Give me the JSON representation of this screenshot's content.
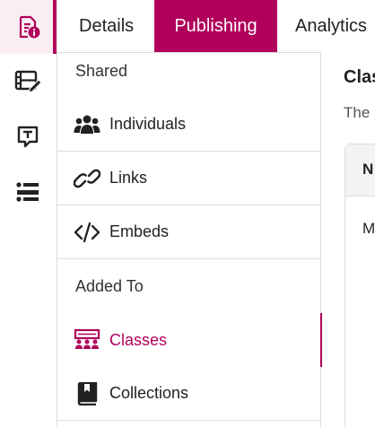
{
  "rail": {
    "items": [
      {
        "icon": "document-info-icon",
        "active": true
      },
      {
        "icon": "video-edit-icon",
        "active": false
      },
      {
        "icon": "text-box-icon",
        "active": false
      },
      {
        "icon": "list-icon",
        "active": false
      }
    ]
  },
  "tabs": [
    {
      "label": "Details"
    },
    {
      "label": "Publishing"
    },
    {
      "label": "Analytics"
    }
  ],
  "panel": {
    "shared_label": "Shared",
    "shared_items": [
      {
        "label": "Individuals",
        "icon": "people-icon"
      },
      {
        "label": "Links",
        "icon": "link-icon"
      },
      {
        "label": "Embeds",
        "icon": "code-icon"
      }
    ],
    "added_label": "Added To",
    "added_items": [
      {
        "label": "Classes",
        "icon": "classes-icon",
        "active": true
      },
      {
        "label": "Collections",
        "icon": "book-icon",
        "active": false
      }
    ]
  },
  "right": {
    "title": "Clas",
    "description": "The",
    "table_header": "N",
    "first_cell": "M"
  },
  "colors": {
    "accent": "#b0005b",
    "rail_active_bg": "#fbeef3"
  }
}
